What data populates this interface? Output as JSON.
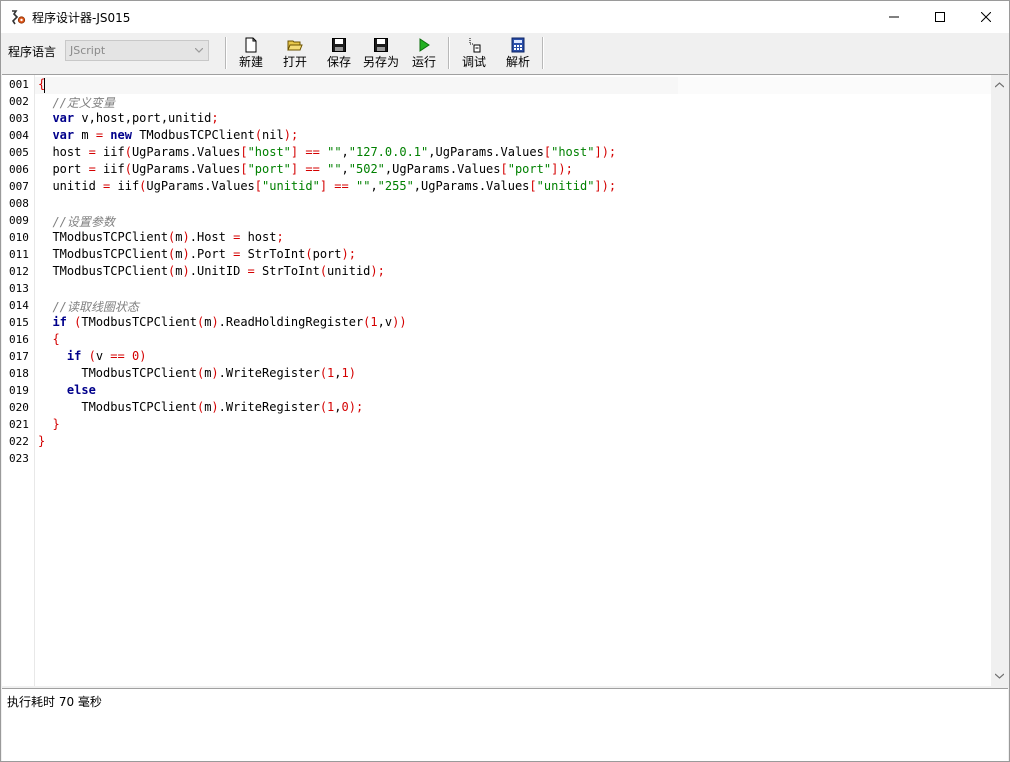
{
  "window": {
    "title": "程序设计器-JS015"
  },
  "toolbar": {
    "lang_label": "程序语言",
    "lang_value": "JScript",
    "buttons": {
      "new": "新建",
      "open": "打开",
      "save": "保存",
      "save_as": "另存为",
      "run": "运行",
      "debug": "调试",
      "parse": "解析"
    }
  },
  "editor": {
    "line_numbers": [
      "001",
      "002",
      "003",
      "004",
      "005",
      "006",
      "007",
      "008",
      "009",
      "010",
      "011",
      "012",
      "013",
      "014",
      "015",
      "016",
      "017",
      "018",
      "019",
      "020",
      "021",
      "022",
      "023"
    ],
    "lines": [
      "{",
      "  //定义变量",
      "  var v,host,port,unitid;",
      "  var m = new TModbusTCPClient(nil);",
      "  host = iif(UgParams.Values[\"host\"] == \"\",\"127.0.0.1\",UgParams.Values[\"host\"]);",
      "  port = iif(UgParams.Values[\"port\"] == \"\",\"502\",UgParams.Values[\"port\"]);",
      "  unitid = iif(UgParams.Values[\"unitid\"] == \"\",\"255\",UgParams.Values[\"unitid\"]);",
      "",
      "  //设置参数",
      "  TModbusTCPClient(m).Host = host;",
      "  TModbusTCPClient(m).Port = StrToInt(port);",
      "  TModbusTCPClient(m).UnitID = StrToInt(unitid);",
      "",
      "  //读取线圈状态",
      "  if (TModbusTCPClient(m).ReadHoldingRegister(1,v))",
      "  {",
      "    if (v == 0)",
      "      TModbusTCPClient(m).WriteRegister(1,1)",
      "    else",
      "      TModbusTCPClient(m).WriteRegister(1,0);",
      "  }",
      "}",
      ""
    ]
  },
  "status": {
    "text": "执行耗时 70 毫秒"
  }
}
